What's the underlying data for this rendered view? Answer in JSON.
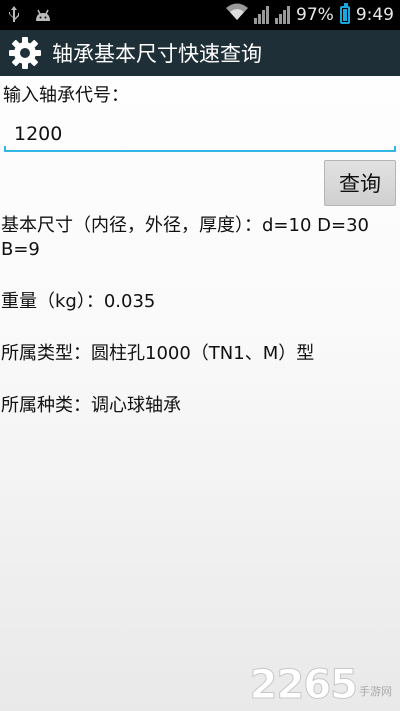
{
  "status_bar": {
    "battery_percent": "97%",
    "time": "9:49",
    "icons": [
      "usb-icon",
      "android-icon",
      "wifi-icon",
      "signal-icon",
      "battery-icon"
    ]
  },
  "action_bar": {
    "title": "轴承基本尺寸快速查询",
    "icon": "gear-icon"
  },
  "form": {
    "input_label": "输入轴承代号：",
    "input_value": "1200",
    "query_button": "查询"
  },
  "results": {
    "dimensions": "基本尺寸（内径，外径，厚度）：d=10 D=30  B=9",
    "weight": "重量（kg）：0.035",
    "type": "所属类型：圆柱孔1000（TN1、M）型",
    "category": "所属种类：调心球轴承"
  },
  "watermark": {
    "number": "2265",
    "suffix": "手游网"
  },
  "colors": {
    "action_bar": "#1f2f37",
    "accent": "#33b5e5",
    "battery": "#1aa7e0"
  }
}
